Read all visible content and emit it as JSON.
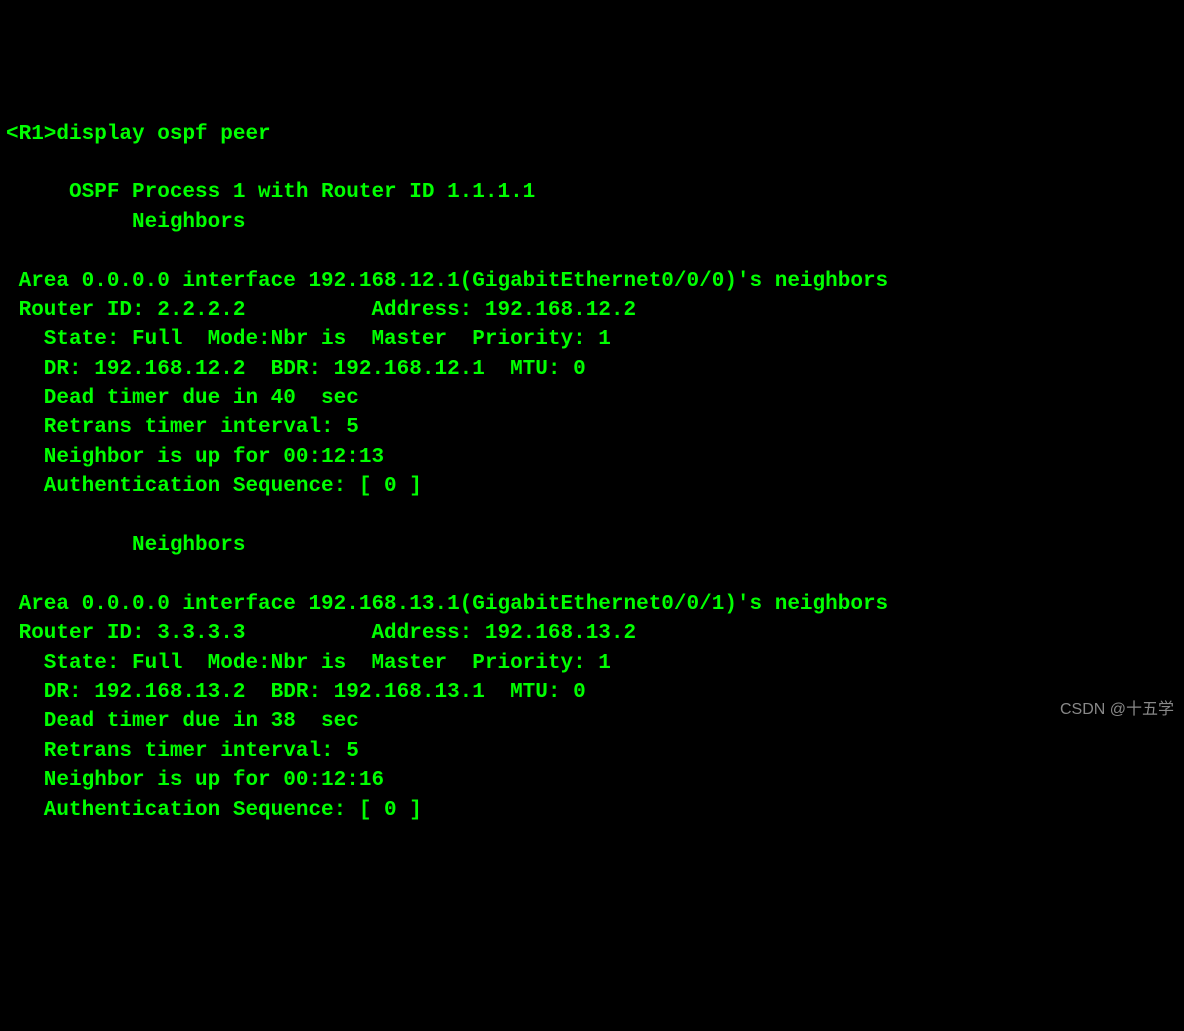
{
  "prompt": "<R1>",
  "command": "display ospf peer",
  "header": {
    "process_line": "     OSPF Process 1 with Router ID 1.1.1.1",
    "neighbors_label": "          Neighbors"
  },
  "neighbors": [
    {
      "area_line": " Area 0.0.0.0 interface 192.168.12.1(GigabitEthernet0/0/0)'s neighbors",
      "router_line": " Router ID: 2.2.2.2          Address: 192.168.12.2",
      "state_line": "   State: Full  Mode:Nbr is  Master  Priority: 1",
      "dr_line": "   DR: 192.168.12.2  BDR: 192.168.12.1  MTU: 0",
      "dead_timer_line": "   Dead timer due in 40  sec",
      "retrans_line": "   Retrans timer interval: 5",
      "uptime_line": "   Neighbor is up for 00:12:13",
      "auth_line": "   Authentication Sequence: [ 0 ]"
    },
    {
      "area_line": " Area 0.0.0.0 interface 192.168.13.1(GigabitEthernet0/0/1)'s neighbors",
      "router_line": " Router ID: 3.3.3.3          Address: 192.168.13.2",
      "state_line": "   State: Full  Mode:Nbr is  Master  Priority: 1",
      "dr_line": "   DR: 192.168.13.2  BDR: 192.168.13.1  MTU: 0",
      "dead_timer_line": "   Dead timer due in 38  sec",
      "retrans_line": "   Retrans timer interval: 5",
      "uptime_line": "   Neighbor is up for 00:12:16",
      "auth_line": "   Authentication Sequence: [ 0 ]"
    }
  ],
  "neighbors_label_mid": "          Neighbors",
  "watermark": "CSDN @十五学"
}
